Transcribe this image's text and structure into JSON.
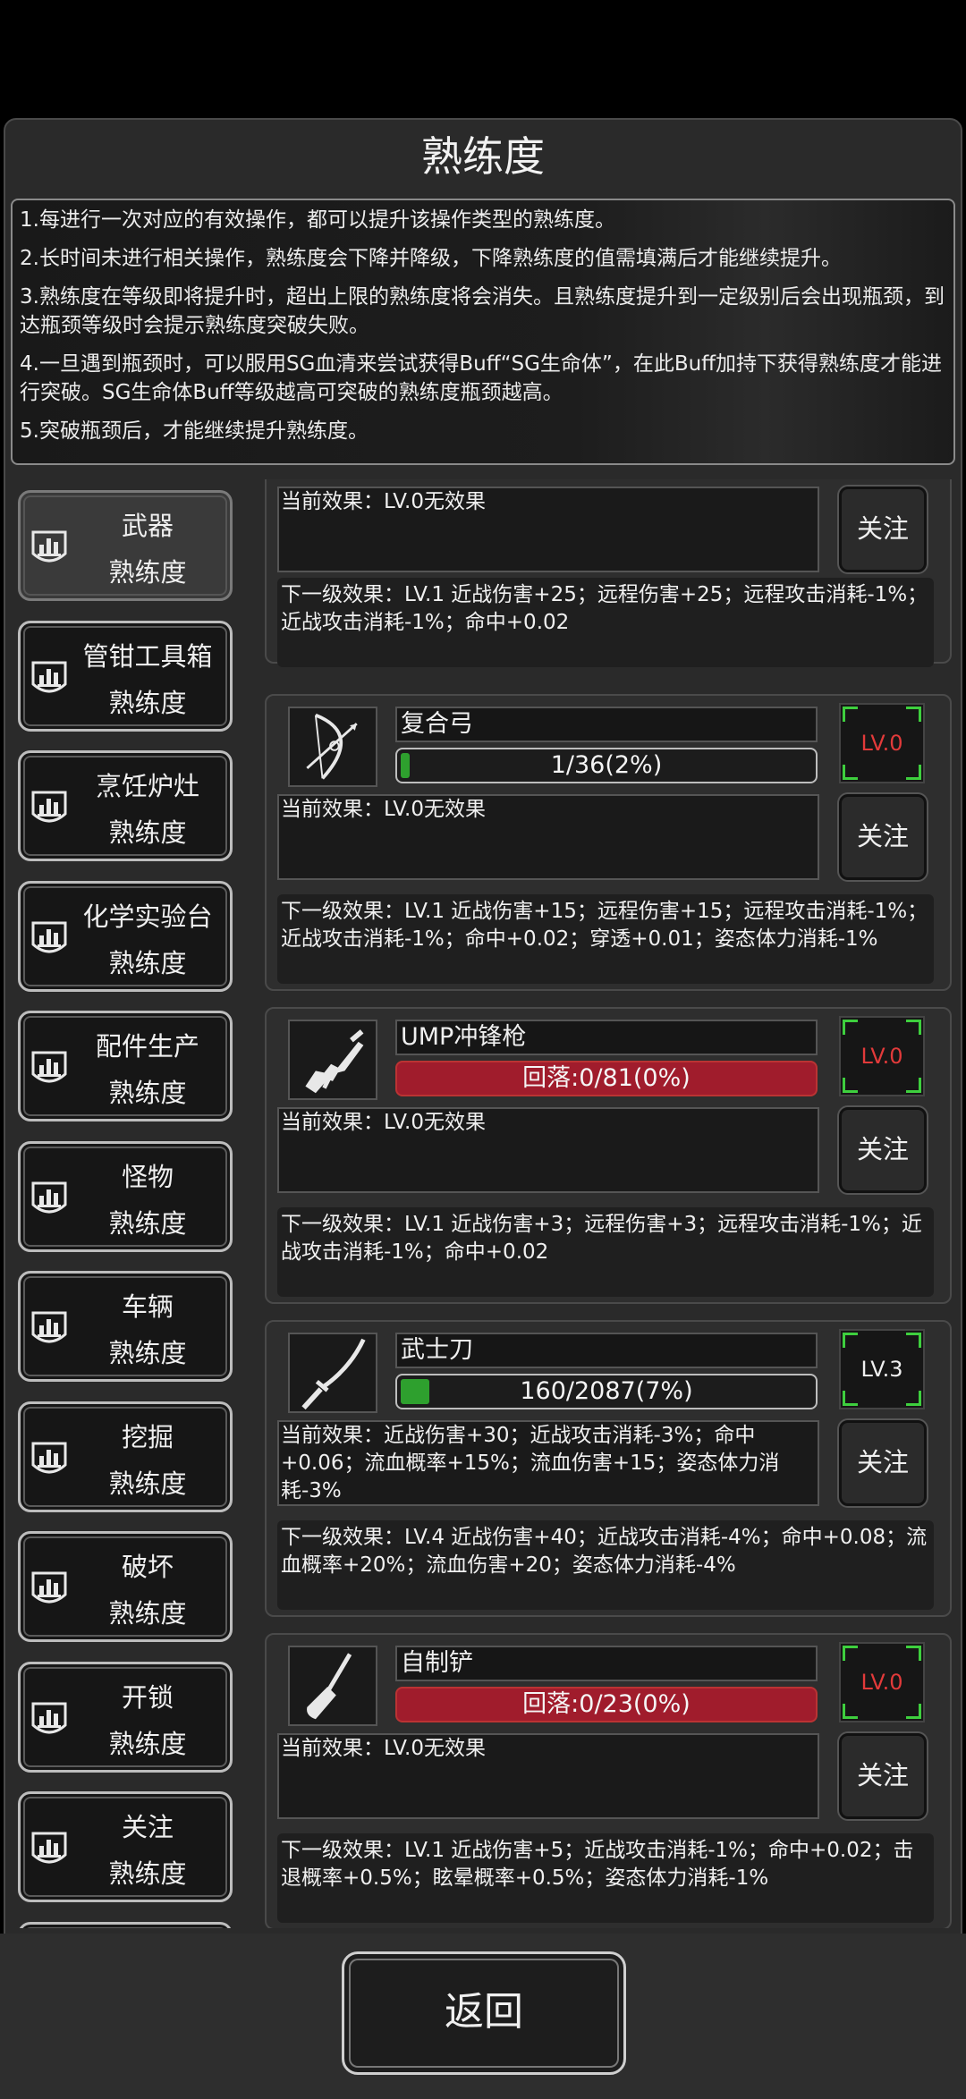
{
  "title": "熟练度",
  "description": [
    "1.每进行一次对应的有效操作，都可以提升该操作类型的熟练度。",
    "2.长时间未进行相关操作，熟练度会下降并降级，下降熟练度的值需填满后才能继续提升。",
    "3.熟练度在等级即将提升时，超出上限的熟练度将会消失。且熟练度提升到一定级别后会出现瓶颈，到达瓶颈等级时会提示熟练度突破失败。",
    "4.一旦遇到瓶颈时，可以服用SG血清来尝试获得Buff“SG生命体”，在此Buff加持下获得熟练度才能进行突破。SG生命体Buff等级越高可突破的熟练度瓶颈越高。",
    "5.突破瓶颈后，才能继续提升熟练度。"
  ],
  "sidebar": [
    {
      "line1": "武器",
      "line2": "熟练度",
      "active": true
    },
    {
      "line1": "管钳工具箱",
      "line2": "熟练度"
    },
    {
      "line1": "烹饪炉灶",
      "line2": "熟练度"
    },
    {
      "line1": "化学实验台",
      "line2": "熟练度"
    },
    {
      "line1": "配件生产",
      "line2": "熟练度"
    },
    {
      "line1": "怪物",
      "line2": "熟练度"
    },
    {
      "line1": "车辆",
      "line2": "熟练度"
    },
    {
      "line1": "挖掘",
      "line2": "熟练度"
    },
    {
      "line1": "破坏",
      "line2": "熟练度"
    },
    {
      "line1": "开锁",
      "line2": "熟练度"
    },
    {
      "line1": "关注",
      "line2": "熟练度"
    }
  ],
  "partial_card": {
    "current_effect": "当前效果：LV.0无效果",
    "follow_label": "关注",
    "next_effect": "下一级效果：LV.1 近战伤害+25；远程伤害+25；远程攻击消耗-1%；近战攻击消耗-1%；命中+0.02"
  },
  "cards": [
    {
      "name": "复合弓",
      "icon": "bow-icon",
      "progress_text": "1/36(2%)",
      "progress": 0.02,
      "declining": false,
      "level": "LV.0",
      "level_color": "#e23a3a",
      "current_effect": "当前效果：LV.0无效果",
      "follow_label": "关注",
      "next_effect": "下一级效果：LV.1 近战伤害+15；远程伤害+15；远程攻击消耗-1%；近战攻击消耗-1%；命中+0.02；穿透+0.01；姿态体力消耗-1%"
    },
    {
      "name": "UMP冲锋枪",
      "icon": "smg-icon",
      "progress_text": "回落:0/81(0%)",
      "progress": 0,
      "declining": true,
      "level": "LV.0",
      "level_color": "#e23a3a",
      "current_effect": "当前效果：LV.0无效果",
      "follow_label": "关注",
      "next_effect": "下一级效果：LV.1 近战伤害+3；远程伤害+3；远程攻击消耗-1%；近战攻击消耗-1%；命中+0.02"
    },
    {
      "name": "武士刀",
      "icon": "katana-icon",
      "progress_text": "160/2087(7%)",
      "progress": 0.07,
      "declining": false,
      "level": "LV.3",
      "level_color": "#f0f0f0",
      "current_effect": "当前效果：近战伤害+30；近战攻击消耗-3%；命中+0.06；流血概率+15%；流血伤害+15；姿态体力消耗-3%",
      "follow_label": "关注",
      "next_effect": "下一级效果：LV.4 近战伤害+40；近战攻击消耗-4%；命中+0.08；流血概率+20%；流血伤害+20；姿态体力消耗-4%"
    },
    {
      "name": "自制铲",
      "icon": "shovel-icon",
      "progress_text": "回落:0/23(0%)",
      "progress": 0,
      "declining": true,
      "level": "LV.0",
      "level_color": "#e23a3a",
      "current_effect": "当前效果：LV.0无效果",
      "follow_label": "关注",
      "next_effect": "下一级效果：LV.1 近战伤害+5；近战攻击消耗-1%；命中+0.02；击退概率+0.5%；眩晕概率+0.5%；姿态体力消耗-1%"
    }
  ],
  "back_label": "返回"
}
